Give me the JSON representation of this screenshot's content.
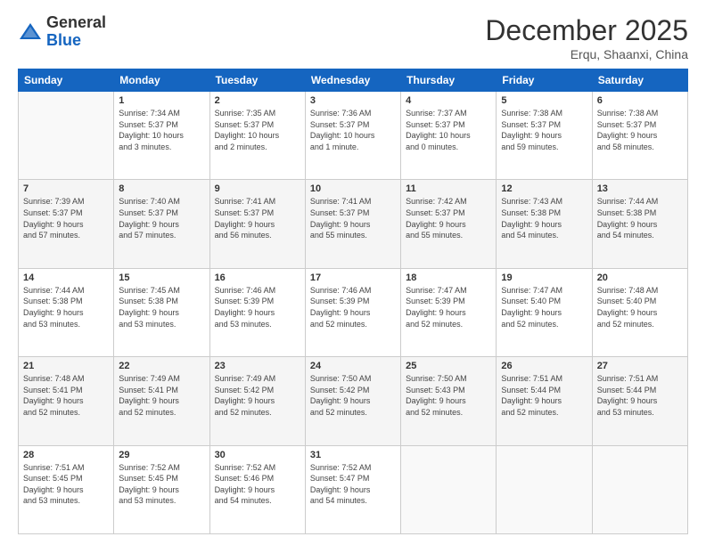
{
  "logo": {
    "general": "General",
    "blue": "Blue"
  },
  "header": {
    "month": "December 2025",
    "location": "Erqu, Shaanxi, China"
  },
  "weekdays": [
    "Sunday",
    "Monday",
    "Tuesday",
    "Wednesday",
    "Thursday",
    "Friday",
    "Saturday"
  ],
  "weeks": [
    [
      {
        "day": "",
        "info": ""
      },
      {
        "day": "1",
        "info": "Sunrise: 7:34 AM\nSunset: 5:37 PM\nDaylight: 10 hours\nand 3 minutes."
      },
      {
        "day": "2",
        "info": "Sunrise: 7:35 AM\nSunset: 5:37 PM\nDaylight: 10 hours\nand 2 minutes."
      },
      {
        "day": "3",
        "info": "Sunrise: 7:36 AM\nSunset: 5:37 PM\nDaylight: 10 hours\nand 1 minute."
      },
      {
        "day": "4",
        "info": "Sunrise: 7:37 AM\nSunset: 5:37 PM\nDaylight: 10 hours\nand 0 minutes."
      },
      {
        "day": "5",
        "info": "Sunrise: 7:38 AM\nSunset: 5:37 PM\nDaylight: 9 hours\nand 59 minutes."
      },
      {
        "day": "6",
        "info": "Sunrise: 7:38 AM\nSunset: 5:37 PM\nDaylight: 9 hours\nand 58 minutes."
      }
    ],
    [
      {
        "day": "7",
        "info": "Sunrise: 7:39 AM\nSunset: 5:37 PM\nDaylight: 9 hours\nand 57 minutes."
      },
      {
        "day": "8",
        "info": "Sunrise: 7:40 AM\nSunset: 5:37 PM\nDaylight: 9 hours\nand 57 minutes."
      },
      {
        "day": "9",
        "info": "Sunrise: 7:41 AM\nSunset: 5:37 PM\nDaylight: 9 hours\nand 56 minutes."
      },
      {
        "day": "10",
        "info": "Sunrise: 7:41 AM\nSunset: 5:37 PM\nDaylight: 9 hours\nand 55 minutes."
      },
      {
        "day": "11",
        "info": "Sunrise: 7:42 AM\nSunset: 5:37 PM\nDaylight: 9 hours\nand 55 minutes."
      },
      {
        "day": "12",
        "info": "Sunrise: 7:43 AM\nSunset: 5:38 PM\nDaylight: 9 hours\nand 54 minutes."
      },
      {
        "day": "13",
        "info": "Sunrise: 7:44 AM\nSunset: 5:38 PM\nDaylight: 9 hours\nand 54 minutes."
      }
    ],
    [
      {
        "day": "14",
        "info": "Sunrise: 7:44 AM\nSunset: 5:38 PM\nDaylight: 9 hours\nand 53 minutes."
      },
      {
        "day": "15",
        "info": "Sunrise: 7:45 AM\nSunset: 5:38 PM\nDaylight: 9 hours\nand 53 minutes."
      },
      {
        "day": "16",
        "info": "Sunrise: 7:46 AM\nSunset: 5:39 PM\nDaylight: 9 hours\nand 53 minutes."
      },
      {
        "day": "17",
        "info": "Sunrise: 7:46 AM\nSunset: 5:39 PM\nDaylight: 9 hours\nand 52 minutes."
      },
      {
        "day": "18",
        "info": "Sunrise: 7:47 AM\nSunset: 5:39 PM\nDaylight: 9 hours\nand 52 minutes."
      },
      {
        "day": "19",
        "info": "Sunrise: 7:47 AM\nSunset: 5:40 PM\nDaylight: 9 hours\nand 52 minutes."
      },
      {
        "day": "20",
        "info": "Sunrise: 7:48 AM\nSunset: 5:40 PM\nDaylight: 9 hours\nand 52 minutes."
      }
    ],
    [
      {
        "day": "21",
        "info": "Sunrise: 7:48 AM\nSunset: 5:41 PM\nDaylight: 9 hours\nand 52 minutes."
      },
      {
        "day": "22",
        "info": "Sunrise: 7:49 AM\nSunset: 5:41 PM\nDaylight: 9 hours\nand 52 minutes."
      },
      {
        "day": "23",
        "info": "Sunrise: 7:49 AM\nSunset: 5:42 PM\nDaylight: 9 hours\nand 52 minutes."
      },
      {
        "day": "24",
        "info": "Sunrise: 7:50 AM\nSunset: 5:42 PM\nDaylight: 9 hours\nand 52 minutes."
      },
      {
        "day": "25",
        "info": "Sunrise: 7:50 AM\nSunset: 5:43 PM\nDaylight: 9 hours\nand 52 minutes."
      },
      {
        "day": "26",
        "info": "Sunrise: 7:51 AM\nSunset: 5:44 PM\nDaylight: 9 hours\nand 52 minutes."
      },
      {
        "day": "27",
        "info": "Sunrise: 7:51 AM\nSunset: 5:44 PM\nDaylight: 9 hours\nand 53 minutes."
      }
    ],
    [
      {
        "day": "28",
        "info": "Sunrise: 7:51 AM\nSunset: 5:45 PM\nDaylight: 9 hours\nand 53 minutes."
      },
      {
        "day": "29",
        "info": "Sunrise: 7:52 AM\nSunset: 5:45 PM\nDaylight: 9 hours\nand 53 minutes."
      },
      {
        "day": "30",
        "info": "Sunrise: 7:52 AM\nSunset: 5:46 PM\nDaylight: 9 hours\nand 54 minutes."
      },
      {
        "day": "31",
        "info": "Sunrise: 7:52 AM\nSunset: 5:47 PM\nDaylight: 9 hours\nand 54 minutes."
      },
      {
        "day": "",
        "info": ""
      },
      {
        "day": "",
        "info": ""
      },
      {
        "day": "",
        "info": ""
      }
    ]
  ]
}
